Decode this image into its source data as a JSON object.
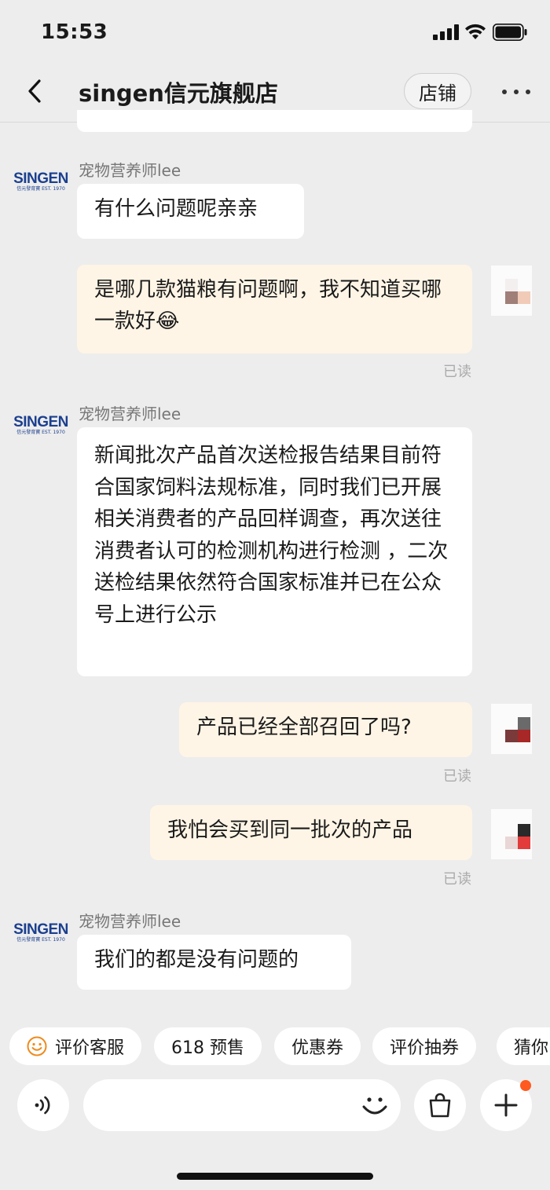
{
  "status_bar": {
    "time": "15:53"
  },
  "header": {
    "title": "singen信元旗舰店",
    "store_label": "店铺"
  },
  "shop": {
    "brand": "SINGEN",
    "brand_sub": "信元發育寶 EST. 1970",
    "sender_name": "宠物营养师lee"
  },
  "messages": [
    {
      "side": "in",
      "sender": "宠物营养师lee",
      "text": "有什么问题呢亲亲"
    },
    {
      "side": "out",
      "text": "是哪几款猫粮有问题啊，我不知道买哪一款好😂",
      "status": "已读"
    },
    {
      "side": "in",
      "sender": "宠物营养师lee",
      "text": "新闻批次产品首次送检报告结果目前符合国家饲料法规标准，同时我们已开展相关消费者的产品回样调查，再次送往消费者认可的检测机构进行检测 ，二次送检结果依然符合国家标准并已在公众号上进行公示"
    },
    {
      "side": "out",
      "text": "产品已经全部召回了吗?",
      "status": "已读"
    },
    {
      "side": "out",
      "text": "我怕会买到同一批次的产品",
      "status": "已读"
    },
    {
      "side": "in",
      "sender": "宠物营养师lee",
      "text": "我们的都是没有问题的"
    }
  ],
  "quick_chips": [
    "评价客服",
    "618 预售",
    "优惠券",
    "评价抽券",
    "猜你"
  ],
  "input": {
    "value": "",
    "placeholder": ""
  },
  "colors": {
    "background": "#ededed",
    "incoming_bubble": "#ffffff",
    "outgoing_bubble": "#fff5e6",
    "accent": "#ff5a1f",
    "brand": "#1b3f8f"
  }
}
